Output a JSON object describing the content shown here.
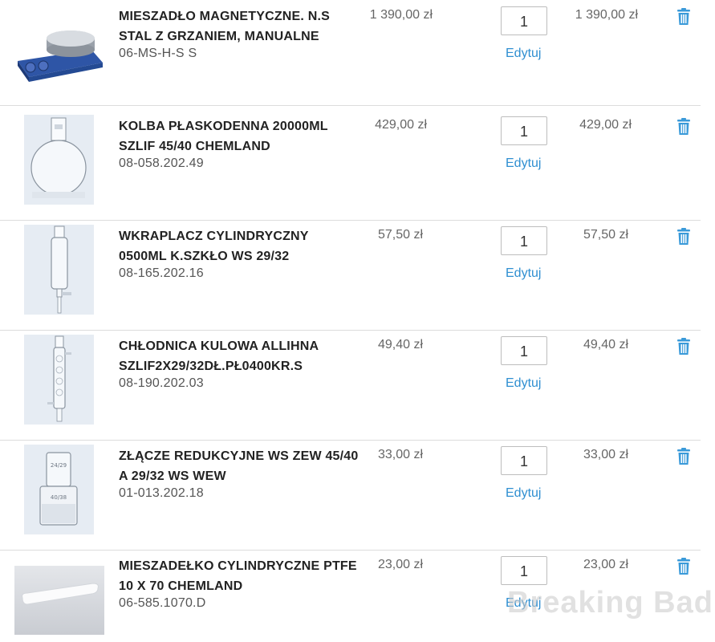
{
  "cart": {
    "items": [
      {
        "name": "MIESZADŁO MAGNETYCZNE. N.S STAL Z GRZANIEM, MANUALNE",
        "code": "06-MS-H-S S",
        "price": "1 390,00 zł",
        "quantity": "1",
        "edit_label": "Edytuj",
        "total": "1 390,00 zł",
        "image_icon": "magnetic-stirrer"
      },
      {
        "name": "KOLBA PŁASKODENNA 20000ML SZLIF 45/40 CHEMLAND",
        "code": "08-058.202.49",
        "price": "429,00 zł",
        "quantity": "1",
        "edit_label": "Edytuj",
        "total": "429,00 zł",
        "image_icon": "flat-bottom-flask"
      },
      {
        "name": "WKRAPLACZ CYLINDRYCZNY 0500ML K.SZKŁO WS 29/32",
        "code": "08-165.202.16",
        "price": "57,50 zł",
        "quantity": "1",
        "edit_label": "Edytuj",
        "total": "57,50 zł",
        "image_icon": "dropping-funnel"
      },
      {
        "name": "CHŁODNICA KULOWA ALLIHNA SZLIF2X29/32DŁ.PŁ0400KR.S",
        "code": "08-190.202.03",
        "price": "49,40 zł",
        "quantity": "1",
        "edit_label": "Edytuj",
        "total": "49,40 zł",
        "image_icon": "allihn-condenser"
      },
      {
        "name": "ZŁĄCZE REDUKCYJNE WS ZEW 45/40 A 29/32 WS WEW",
        "code": "01-013.202.18",
        "price": "33,00 zł",
        "quantity": "1",
        "edit_label": "Edytuj",
        "total": "33,00 zł",
        "image_icon": "reduction-adapter",
        "image_labels": [
          "24/29",
          "40/38"
        ]
      },
      {
        "name": "MIESZADEŁKO CYLINDRYCZNE PTFE 10 X 70 CHEMLAND",
        "code": "06-585.1070.D",
        "price": "23,00 zł",
        "quantity": "1",
        "edit_label": "Edytuj",
        "total": "23,00 zł",
        "image_icon": "stir-bar"
      }
    ]
  },
  "watermark": "Breaking Bad",
  "colors": {
    "link": "#2f8fd1",
    "trash": "#3a9ad9",
    "divider": "#dcdcdc"
  }
}
